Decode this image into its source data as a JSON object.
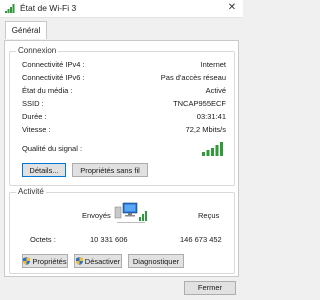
{
  "window": {
    "title": "État de Wi-Fi 3",
    "close_glyph": "✕"
  },
  "tabs": [
    {
      "label": "Général"
    }
  ],
  "connection": {
    "group_label": "Connexion",
    "rows": [
      {
        "label": "Connectivité IPv4 :",
        "value": "Internet"
      },
      {
        "label": "Connectivité IPv6 :",
        "value": "Pas d'accès réseau"
      },
      {
        "label": "État du média :",
        "value": "Activé"
      },
      {
        "label": "SSID :",
        "value": "TNCAP955ECF"
      },
      {
        "label": "Durée :",
        "value": "03:31:41"
      },
      {
        "label": "Vitesse :",
        "value": "72,2 Mbits/s"
      }
    ],
    "signal_label": "Qualité du signal :",
    "signal_bars_lit": 5,
    "signal_bars_total": 5,
    "signal_icon": "signal-bars-icon",
    "details_button": "Détails...",
    "wireless_props_button": "Propriétés sans fil"
  },
  "activity": {
    "group_label": "Activité",
    "sent_label": "Envoyés",
    "received_label": "Reçus",
    "bytes_label": "Octets :",
    "sent_bytes": "10 331 606",
    "received_bytes": "146 673 452",
    "network_icon": "network-computers-icon"
  },
  "actions": {
    "properties_button": "Propriétés",
    "disable_button": "Désactiver",
    "diagnose_button": "Diagnostiquer",
    "shield_icon": "uac-shield-icon"
  },
  "footer": {
    "close_button": "Fermer"
  },
  "colors": {
    "signal_green": "#2e9a3a",
    "focus_blue": "#0078d7",
    "monitor_blue": "#1f6fd1"
  }
}
